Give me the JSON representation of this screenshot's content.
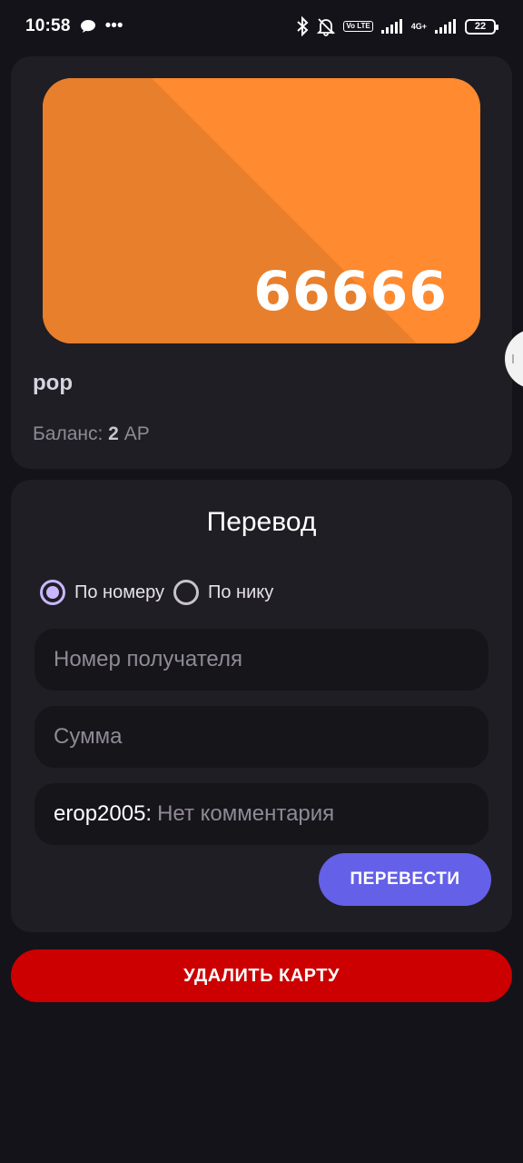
{
  "status_bar": {
    "time": "10:58",
    "more": "•••",
    "network_label": "4G+",
    "volte_label": "Vo LTE",
    "battery_level": "22"
  },
  "card": {
    "number": "66666",
    "name": "pop",
    "balance_label": "Баланс:",
    "balance_value": "2",
    "balance_unit": "АР",
    "color_primary": "#ff8a30",
    "color_shade": "#e87f2c"
  },
  "transfer": {
    "title": "Перевод",
    "options": [
      {
        "label": "По номеру",
        "selected": true
      },
      {
        "label": "По нику",
        "selected": false
      }
    ],
    "recipient_placeholder": "Номер получателя",
    "amount_placeholder": "Сумма",
    "comment_prefix": "erop2005:",
    "comment_placeholder": "Нет комментария",
    "submit_label": "ПЕРЕВЕСТИ"
  },
  "delete_label": "УДАЛИТЬ КАРТУ",
  "colors": {
    "background": "#15131a",
    "panel": "#1f1e24",
    "accent": "#6560e8",
    "danger": "#cc0000",
    "radio_selected": "#c9b7ff"
  }
}
